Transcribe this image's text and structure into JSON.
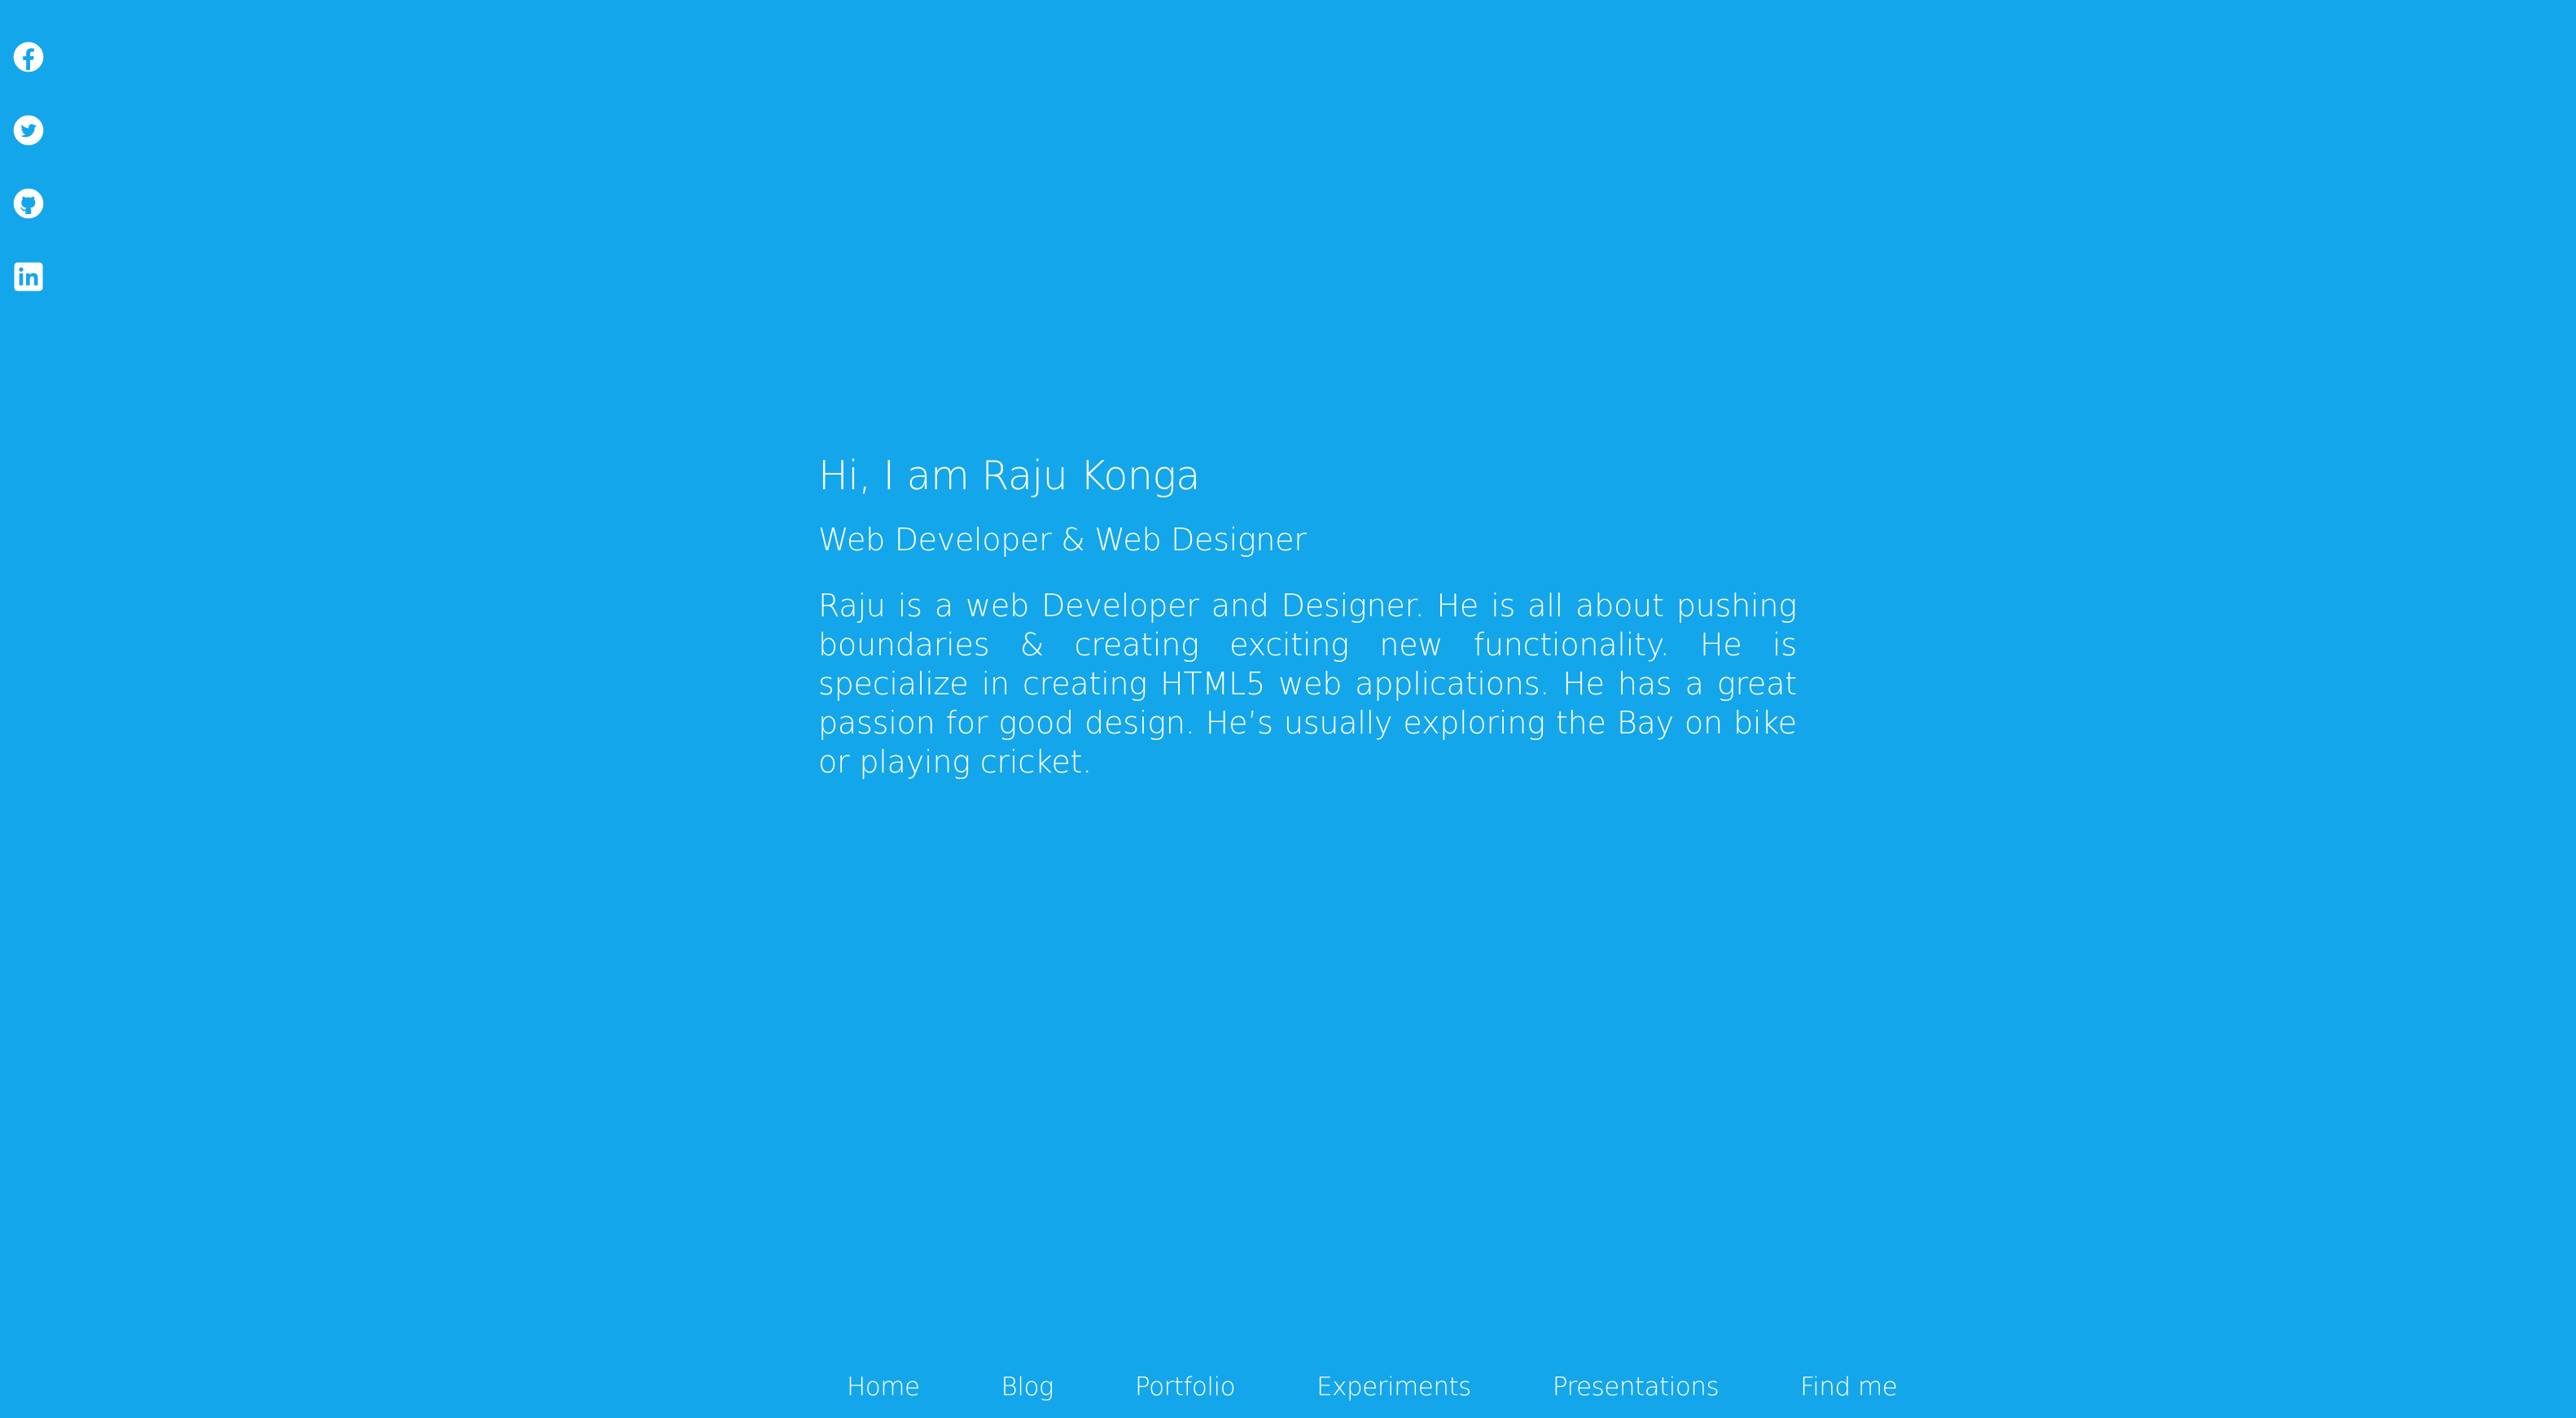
{
  "colors": {
    "background": "#14a6ea",
    "foreground": "#ffffff"
  },
  "social": [
    {
      "name": "facebook",
      "icon": "facebook-icon"
    },
    {
      "name": "twitter",
      "icon": "twitter-icon"
    },
    {
      "name": "github",
      "icon": "github-icon"
    },
    {
      "name": "linkedin",
      "icon": "linkedin-icon"
    }
  ],
  "intro": {
    "heading": "Hi, I am Raju Konga",
    "subheading": "Web Developer & Web Designer",
    "bio": "Raju is a web Developer and Designer. He is all about pushing boundaries & creating exciting new functionality. He is specialize in creating HTML5 web applications. He has a great passion for good design. He’s usually exploring the Bay on bike or playing cricket."
  },
  "nav": {
    "items": [
      "Home",
      "Blog",
      "Portfolio",
      "Experiments",
      "Presentations",
      "Find me"
    ]
  }
}
